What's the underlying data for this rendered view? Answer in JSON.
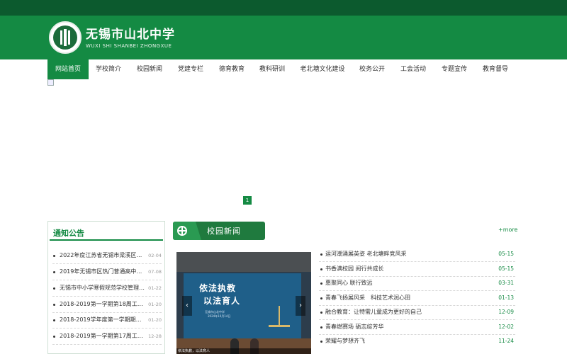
{
  "site": {
    "title_cn": "无锡市山北中学",
    "title_en": "WUXI SHI SHANBEI ZHONGXUE"
  },
  "nav": [
    {
      "label": "网站首页",
      "active": true
    },
    {
      "label": "学校简介",
      "active": false
    },
    {
      "label": "校园新闻",
      "active": false
    },
    {
      "label": "党建专栏",
      "active": false
    },
    {
      "label": "德育教育",
      "active": false
    },
    {
      "label": "教科研训",
      "active": false
    },
    {
      "label": "老北塘文化建设",
      "active": false
    },
    {
      "label": "校务公开",
      "active": false
    },
    {
      "label": "工会活动",
      "active": false
    },
    {
      "label": "专题宣传",
      "active": false
    },
    {
      "label": "教育督导",
      "active": false
    }
  ],
  "banner": {
    "page": "1"
  },
  "notice": {
    "title": "通知公告",
    "items": [
      {
        "text": "2022年度江苏省无锡市梁溪区无…",
        "date": "02-04"
      },
      {
        "text": "2019年无锡市区热门普通高中分…",
        "date": "07-08"
      },
      {
        "text": "无锡市中小学寒假规范学校管理…",
        "date": "01-22"
      },
      {
        "text": "2018-2019第一学期第18周工作安排",
        "date": "01-20"
      },
      {
        "text": "2018-2019学年度第一学期期末工…",
        "date": "01-20"
      },
      {
        "text": "2018-2019第一学期第17周工作安排",
        "date": "12-28"
      }
    ]
  },
  "news": {
    "title": "校园新闻",
    "more": "+more",
    "photo": {
      "screen_line1": "依法执教",
      "screen_line2": "以法育人",
      "screen_line3": "无锡市山北中学",
      "screen_line4": "2024年10月14日",
      "caption": "依法执教，以法育人",
      "prev": "‹",
      "next": "›"
    },
    "items": [
      {
        "text": "运河潮涌展英姿 老北塘畔竞风采",
        "date": "05-15"
      },
      {
        "text": "书香满校园 阅行共成长",
        "date": "05-15"
      },
      {
        "text": "惠聚同心 联行致远",
        "date": "03-31"
      },
      {
        "text": "青春飞扬展风采　科技艺术润心田",
        "date": "01-13"
      },
      {
        "text": "融合教育：让特需儿童成为更好的自己",
        "date": "12-09"
      },
      {
        "text": "青春燃赛场 砺志绽芳华",
        "date": "12-02"
      },
      {
        "text": "荣耀与梦想齐飞",
        "date": "11-24"
      }
    ]
  }
}
